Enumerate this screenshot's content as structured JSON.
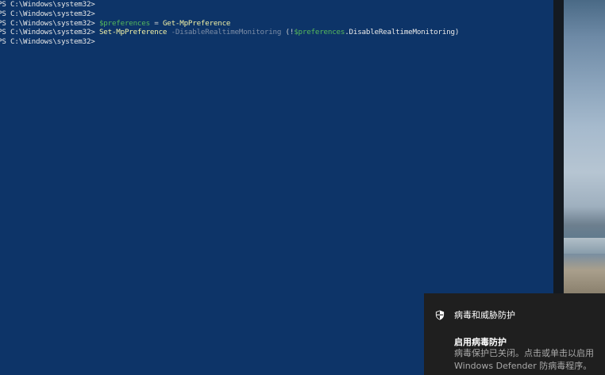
{
  "console": {
    "lines": [
      [
        {
          "cls": "tok-text",
          "t": "PS C:\\Windows\\system32>"
        }
      ],
      [
        {
          "cls": "tok-text",
          "t": "PS C:\\Windows\\system32>"
        }
      ],
      [
        {
          "cls": "tok-text",
          "t": "PS C:\\Windows\\system32> "
        },
        {
          "cls": "tok-var",
          "t": "$preferences"
        },
        {
          "cls": "tok-op",
          "t": " = "
        },
        {
          "cls": "tok-cmd",
          "t": "Get-MpPreference"
        }
      ],
      [
        {
          "cls": "tok-text",
          "t": "PS C:\\Windows\\system32> "
        },
        {
          "cls": "tok-cmd",
          "t": "Set-MpPreference"
        },
        {
          "cls": "tok-param",
          "t": " -DisableRealtimeMonitoring "
        },
        {
          "cls": "tok-op",
          "t": "(!"
        },
        {
          "cls": "tok-var",
          "t": "$preferences"
        },
        {
          "cls": "tok-text",
          "t": ".DisableRealtimeMonitoring)"
        }
      ],
      [
        {
          "cls": "tok-text",
          "t": "PS C:\\Windows\\system32>"
        }
      ]
    ]
  },
  "toast": {
    "app_name": "病毒和威胁防护",
    "title": "启用病毒防护",
    "body_line1": "病毒保护已关闭。点击或单击以启用",
    "body_line2": "Windows Defender 防病毒程序。",
    "icon": "shield-icon"
  },
  "colors": {
    "console_bg": "#0d3468",
    "variable": "#56b95b",
    "command": "#f2f2a6",
    "parameter": "#7b8ca6",
    "toast_bg": "#1f1f1f"
  }
}
